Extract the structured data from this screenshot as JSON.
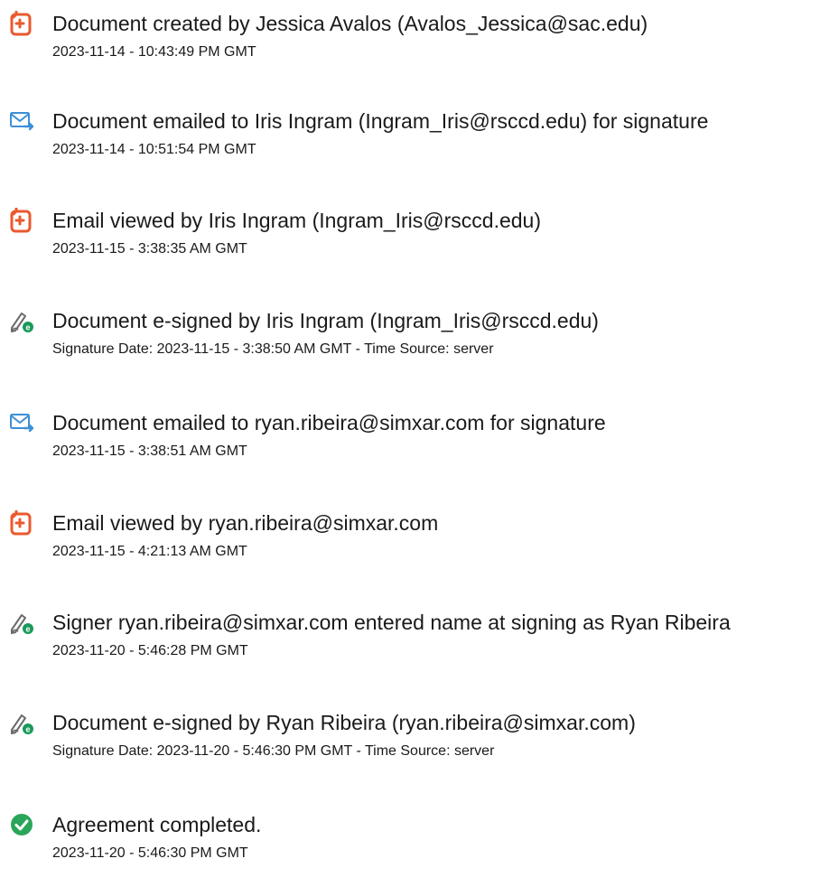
{
  "events": [
    {
      "icon": "document-created-icon",
      "title": "Document created by Jessica Avalos (Avalos_Jessica@sac.edu)",
      "sub": "2023-11-14 - 10:43:49 PM GMT"
    },
    {
      "icon": "email-sent-icon",
      "title": "Document emailed to Iris Ingram (Ingram_Iris@rsccd.edu) for signature",
      "sub": "2023-11-14 - 10:51:54 PM GMT"
    },
    {
      "icon": "document-viewed-icon",
      "title": "Email viewed by Iris Ingram (Ingram_Iris@rsccd.edu)",
      "sub": "2023-11-15 - 3:38:35 AM GMT"
    },
    {
      "icon": "e-sign-icon",
      "title": "Document e-signed by Iris Ingram (Ingram_Iris@rsccd.edu)",
      "sub": "Signature Date: 2023-11-15 - 3:38:50 AM GMT - Time Source: server"
    },
    {
      "icon": "email-sent-icon",
      "title": "Document emailed to ryan.ribeira@simxar.com for signature",
      "sub": "2023-11-15 - 3:38:51 AM GMT"
    },
    {
      "icon": "document-viewed-icon",
      "title": "Email viewed by ryan.ribeira@simxar.com",
      "sub": "2023-11-15 - 4:21:13 AM GMT"
    },
    {
      "icon": "e-sign-icon",
      "title": "Signer ryan.ribeira@simxar.com entered name at signing as Ryan Ribeira",
      "sub": "2023-11-20 - 5:46:28 PM GMT"
    },
    {
      "icon": "e-sign-icon",
      "title": "Document e-signed by Ryan Ribeira (ryan.ribeira@simxar.com)",
      "sub": "Signature Date: 2023-11-20 - 5:46:30 PM GMT - Time Source: server"
    },
    {
      "icon": "agreement-complete-icon",
      "title": "Agreement completed.",
      "sub": "2023-11-20 - 5:46:30 PM GMT"
    }
  ],
  "colors": {
    "doc_icon": "#ea5a2e",
    "mail_icon": "#3d8fd6",
    "sign_icon": "#6b6b6b",
    "sign_badge": "#1a9a5a",
    "complete_icon": "#2aa55a"
  }
}
